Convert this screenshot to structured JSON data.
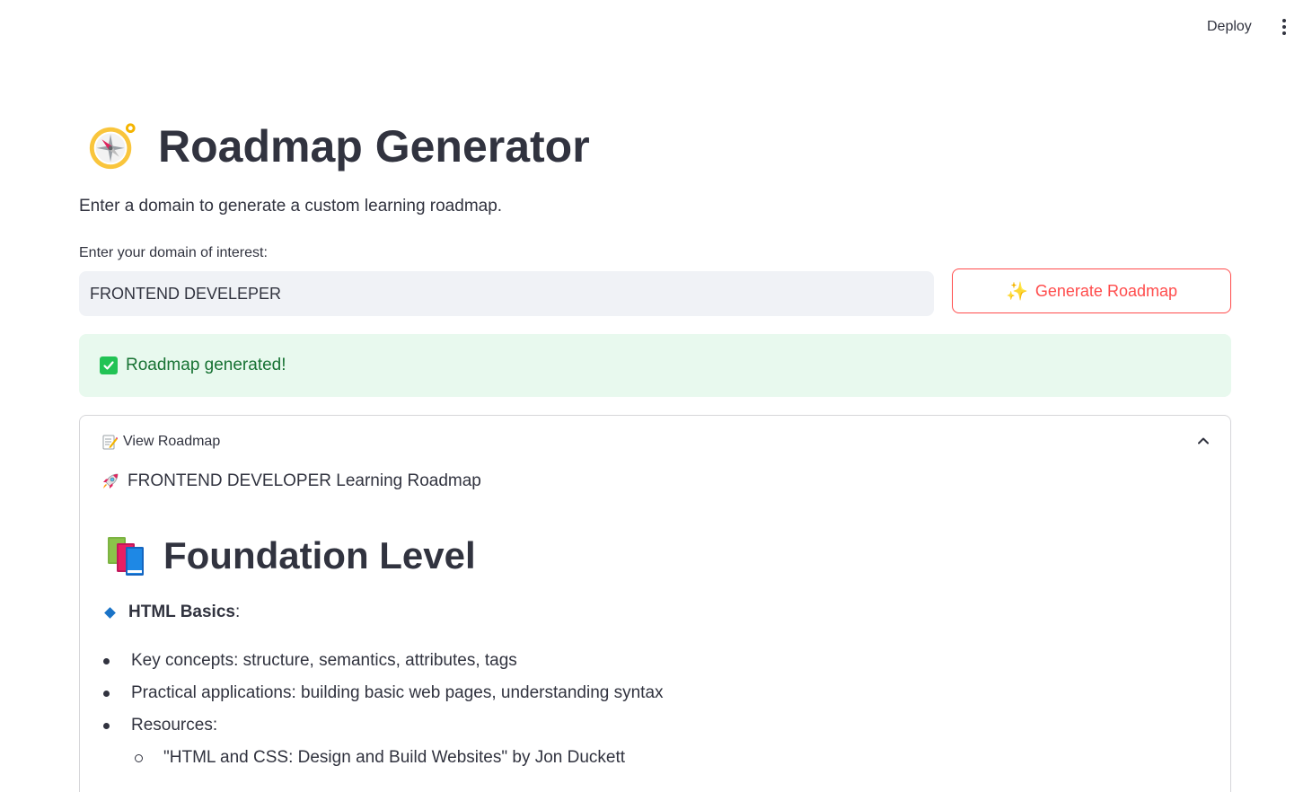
{
  "header": {
    "deploy_label": "Deploy",
    "menu_icon": "more-vertical-icon"
  },
  "page": {
    "title": "Roadmap Generator",
    "title_icon": "compass-icon",
    "subtitle": "Enter a domain to generate a custom learning roadmap."
  },
  "form": {
    "input_label": "Enter your domain of interest:",
    "input_value": "FRONTEND DEVELEPER",
    "button_icon": "✨",
    "button_label": "Generate Roadmap"
  },
  "alert": {
    "text": "Roadmap generated!",
    "color": "#177233",
    "background": "#e8f9ee"
  },
  "expander": {
    "title": "View Roadmap",
    "expanded": true,
    "roadmap_heading": "FRONTEND DEVELOPER Learning Roadmap",
    "level_heading": "Foundation Level",
    "topic": {
      "name": "HTML Basics",
      "suffix": ":"
    },
    "items": [
      "Key concepts: structure, semantics, attributes, tags",
      "Practical applications: building basic web pages, understanding syntax",
      "Resources:"
    ],
    "sub_items": [
      "\"HTML and CSS: Design and Build Websites\" by Jon Duckett"
    ]
  },
  "colors": {
    "accent": "#ff4b4b",
    "text": "#31333f",
    "input_bg": "#f0f2f6"
  }
}
